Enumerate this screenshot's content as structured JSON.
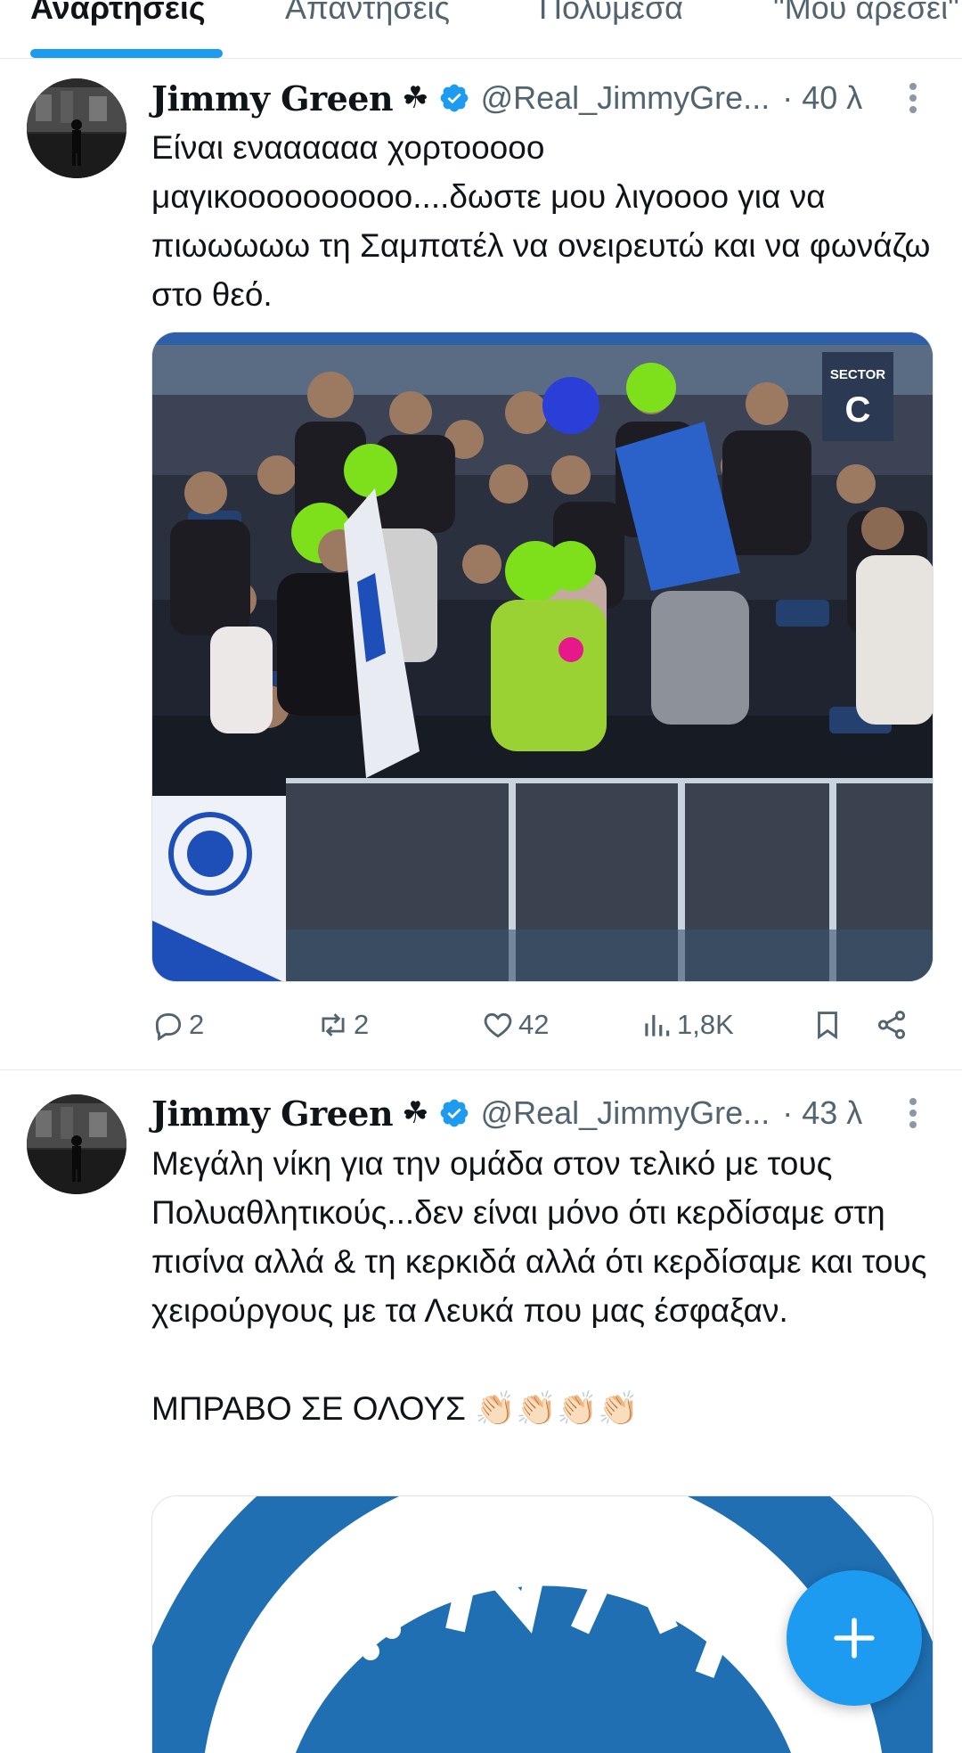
{
  "tabs": [
    {
      "label": "Αναρτήσεις",
      "active": true
    },
    {
      "label": "Απαντήσεις",
      "active": false
    },
    {
      "label": "Πολυμέσα",
      "active": false
    },
    {
      "label": "\"Μου αρέσει\"",
      "active": false
    }
  ],
  "tweets": [
    {
      "author_name": "Jimmy Green",
      "author_emoji": "☘",
      "handle": "@Real_JimmyGre...",
      "time": "· 40 λ",
      "text": "Είναι εναααααα χορτοοοοο μαγικοοοοοοοοοο....δωστε μου λιγοοοο για να πιωωωωω τη Σαμπατέλ να ονειρευτώ και να φωνάζω στο θεό.",
      "media": {
        "sector_label": "SECTOR",
        "sector_letter": "C"
      },
      "replies": "2",
      "retweets": "2",
      "likes": "42",
      "views": "1,8K"
    },
    {
      "author_name": "Jimmy Green",
      "author_emoji": "☘",
      "handle": "@Real_JimmyGre...",
      "time": "· 43 λ",
      "text": "Μεγάλη νίκη για την ομάδα στον τελικό με τους Πολυαθλητικούς...δεν είναι μόνο ότι κερδίσαμε στη πισίνα αλλά & τη κερκιδά αλλά ότι κερδίσαμε και τους χειρούργους με τα Λευκά που μας έσφαξαν.\n\nΜΠΡΑΒΟ ΣΕ ΟΛΟΥΣ 👏🏻👏🏻👏🏻👏🏻"
    }
  ],
  "colors": {
    "accent": "#1d9bf0",
    "text": "#0f1419",
    "muted": "#536471"
  },
  "icons": [
    "reply-icon",
    "retweet-icon",
    "like-icon",
    "views-icon",
    "bookmark-icon",
    "share-icon",
    "more-icon",
    "verified-icon",
    "compose-plus-icon"
  ]
}
